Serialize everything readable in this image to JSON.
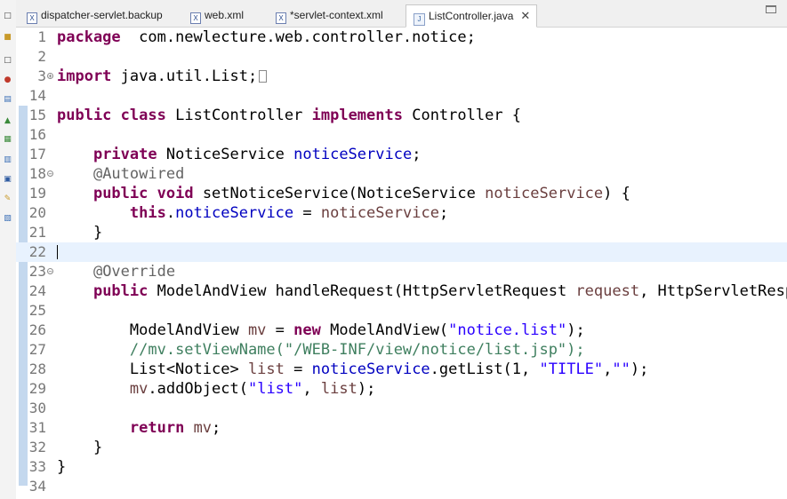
{
  "tabs": [
    {
      "label": "dispatcher-servlet.backup",
      "type": "xml",
      "active": false
    },
    {
      "label": "web.xml",
      "type": "xml",
      "active": false
    },
    {
      "label": "*servlet-context.xml",
      "type": "xml",
      "active": false
    },
    {
      "label": "ListController.java",
      "type": "java",
      "active": true
    }
  ],
  "icons": {
    "xml_file": "xml-file-icon",
    "java_file": "java-file-icon",
    "close": "close-icon",
    "fold": "fold-icon"
  },
  "editor": {
    "current_line": 22,
    "lines": [
      {
        "n": "1",
        "tokens": [
          [
            "kw",
            "package"
          ],
          [
            "",
            "  com.newlecture.web.controller.notice;"
          ]
        ]
      },
      {
        "n": "2",
        "tokens": []
      },
      {
        "n": "3",
        "fold": "plus",
        "tokens": [
          [
            "kw",
            "import"
          ],
          [
            "",
            " java.util.List;"
          ],
          [
            "ellip",
            ""
          ]
        ]
      },
      {
        "n": "14",
        "tokens": []
      },
      {
        "n": "15",
        "tokens": [
          [
            "kw",
            "public"
          ],
          [
            "",
            " "
          ],
          [
            "kw",
            "class"
          ],
          [
            "",
            " ListController "
          ],
          [
            "kw",
            "implements"
          ],
          [
            "",
            " Controller {"
          ]
        ]
      },
      {
        "n": "16",
        "tokens": []
      },
      {
        "n": "17",
        "tokens": [
          [
            "",
            "    "
          ],
          [
            "kw",
            "private"
          ],
          [
            "",
            " NoticeService "
          ],
          [
            "fld",
            "noticeService"
          ],
          [
            "",
            ";"
          ]
        ]
      },
      {
        "n": "18",
        "fold": "minus",
        "tokens": [
          [
            "",
            "    "
          ],
          [
            "ann",
            "@Autowired"
          ]
        ]
      },
      {
        "n": "19",
        "tokens": [
          [
            "",
            "    "
          ],
          [
            "kw",
            "public"
          ],
          [
            "",
            " "
          ],
          [
            "kw",
            "void"
          ],
          [
            "",
            " setNoticeService(NoticeService "
          ],
          [
            "param",
            "noticeService"
          ],
          [
            "",
            ") {"
          ]
        ]
      },
      {
        "n": "20",
        "tokens": [
          [
            "",
            "        "
          ],
          [
            "kw",
            "this"
          ],
          [
            "",
            "."
          ],
          [
            "fld",
            "noticeService"
          ],
          [
            "",
            " = "
          ],
          [
            "param",
            "noticeService"
          ],
          [
            "",
            ";"
          ]
        ]
      },
      {
        "n": "21",
        "tokens": [
          [
            "",
            "    }"
          ]
        ]
      },
      {
        "n": "22",
        "tokens": []
      },
      {
        "n": "23",
        "fold": "minus",
        "tokens": [
          [
            "",
            "    "
          ],
          [
            "ann",
            "@Override"
          ]
        ]
      },
      {
        "n": "24",
        "tokens": [
          [
            "",
            "    "
          ],
          [
            "kw",
            "public"
          ],
          [
            "",
            " ModelAndView handleRequest(HttpServletRequest "
          ],
          [
            "param",
            "request"
          ],
          [
            "",
            ", HttpServletRespo"
          ]
        ]
      },
      {
        "n": "25",
        "tokens": []
      },
      {
        "n": "26",
        "tokens": [
          [
            "",
            "        ModelAndView "
          ],
          [
            "param",
            "mv"
          ],
          [
            "",
            " = "
          ],
          [
            "kw",
            "new"
          ],
          [
            "",
            " ModelAndView("
          ],
          [
            "str",
            "\"notice.list\""
          ],
          [
            "",
            ");"
          ]
        ]
      },
      {
        "n": "27",
        "tokens": [
          [
            "",
            "        "
          ],
          [
            "cmt",
            "//mv.setViewName(\"/WEB-INF/view/notice/list.jsp\");"
          ]
        ]
      },
      {
        "n": "28",
        "tokens": [
          [
            "",
            "        List<Notice> "
          ],
          [
            "param",
            "list"
          ],
          [
            "",
            " = "
          ],
          [
            "fld",
            "noticeService"
          ],
          [
            "",
            ".getList(1, "
          ],
          [
            "str",
            "\"TITLE\""
          ],
          [
            "",
            ","
          ],
          [
            "str",
            "\"\""
          ],
          [
            "",
            ");"
          ]
        ]
      },
      {
        "n": "29",
        "tokens": [
          [
            "",
            "        "
          ],
          [
            "param",
            "mv"
          ],
          [
            "",
            ".addObject("
          ],
          [
            "str",
            "\"list\""
          ],
          [
            "",
            ", "
          ],
          [
            "param",
            "list"
          ],
          [
            "",
            ");"
          ]
        ]
      },
      {
        "n": "30",
        "tokens": []
      },
      {
        "n": "31",
        "tokens": [
          [
            "",
            "        "
          ],
          [
            "kw",
            "return"
          ],
          [
            "",
            " "
          ],
          [
            "param",
            "mv"
          ],
          [
            "",
            ";"
          ]
        ]
      },
      {
        "n": "32",
        "tokens": [
          [
            "",
            "    }"
          ]
        ]
      },
      {
        "n": "33",
        "tokens": [
          [
            "",
            "}"
          ]
        ]
      },
      {
        "n": "34",
        "tokens": []
      }
    ]
  }
}
